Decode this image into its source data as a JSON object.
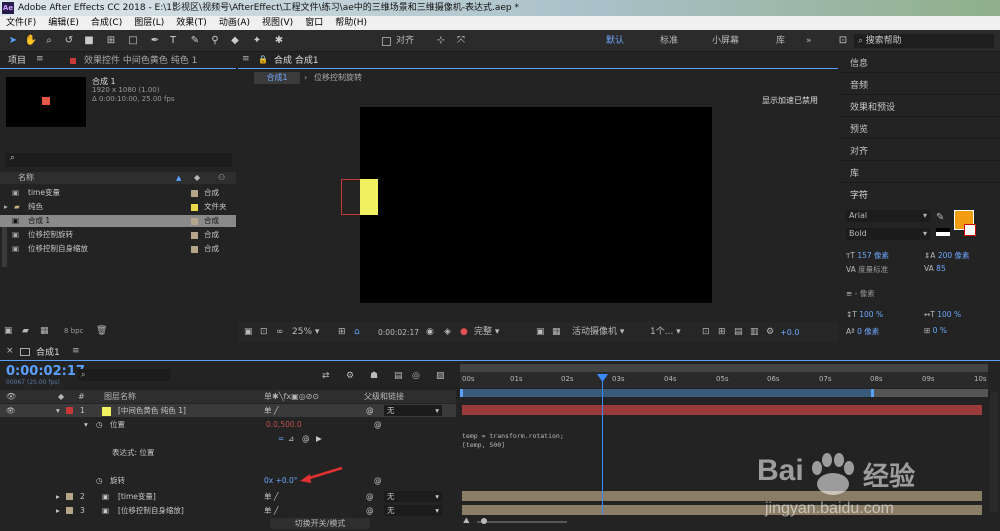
{
  "app": {
    "title": "Adobe After Effects CC 2018 - E:\\1影视区\\视频号\\AfterEffect\\工程文件\\练习\\ae中的三维场景和三维摄像机-表达式.aep *",
    "logo": "Ae"
  },
  "menu": [
    "文件(F)",
    "编辑(E)",
    "合成(C)",
    "图层(L)",
    "效果(T)",
    "动画(A)",
    "视图(V)",
    "窗口",
    "帮助(H)"
  ],
  "toolbar": {
    "align_label": "对齐",
    "workspaces": [
      "默认",
      "标准",
      "小屏幕",
      "库"
    ],
    "search_placeholder": "搜索帮助"
  },
  "project": {
    "tab_label": "项目",
    "effects_tab_label": "效果控件 中间色黄色 纯色 1",
    "comp_name": "合成 1",
    "comp_details": [
      "1920 x 1080 (1.00)",
      "Δ 0:00:10:00, 25.00 fps"
    ],
    "col_name": "名称",
    "items": [
      {
        "name": "time变量",
        "type": "合成",
        "color": "#b5a68a"
      },
      {
        "name": "纯色",
        "type": "文件夹",
        "color": "#e8d84a"
      },
      {
        "name": "合成 1",
        "type": "合成",
        "color": "#b5a68a"
      },
      {
        "name": "位移控制旋转",
        "type": "合成",
        "color": "#b5a68a"
      },
      {
        "name": "位移控制自身缩放",
        "type": "合成",
        "color": "#b5a68a"
      }
    ],
    "bpc": "8 bpc"
  },
  "viewer": {
    "tab_label": "合成 合成1",
    "subtabs": [
      "合成1",
      "位移控制旋转"
    ],
    "accel_note": "显示加速已禁用",
    "zoom": "25%",
    "timecode": "0:00:02:17",
    "quality": "完整",
    "camera": "活动摄像机",
    "views": "1个...",
    "exposure": "+0.0"
  },
  "right_panel": {
    "items": [
      "信息",
      "音频",
      "效果和预设",
      "预览",
      "对齐",
      "库"
    ],
    "character_label": "字符",
    "font": "Arial",
    "style": "Bold",
    "font_size": "157 像素",
    "leading": "200 像素",
    "kerning": "度量标准",
    "tracking": "85",
    "stroke_width": "- 像素",
    "vscale": "100 %",
    "hscale": "100 %",
    "baseline": "0 像素",
    "tsume": "0 %",
    "fill_color": "#f39c12"
  },
  "timeline": {
    "comp_tab": "合成1",
    "current_time": "0:00:02:17",
    "frame_info": "00067 (25.00 fps)",
    "col_layer_name": "图层名称",
    "col_parent": "父级和链接",
    "ruler": [
      "00s",
      "01s",
      "02s",
      "03s",
      "04s",
      "05s",
      "06s",
      "07s",
      "08s",
      "09s",
      "10s"
    ],
    "layers": [
      {
        "num": "1",
        "name": "[中间色黄色 纯色 1]",
        "color": "#c83a3a",
        "parent": "无"
      },
      {
        "num": "2",
        "name": "[time变量]",
        "color": "#b5a68a",
        "parent": "无"
      },
      {
        "num": "3",
        "name": "[位移控制自身缩放]",
        "color": "#b5a68a",
        "parent": "无"
      }
    ],
    "position_label": "位置",
    "position_value": "0.0,500.0",
    "expression_label": "表达式: 位置",
    "rotation_label": "旋转",
    "rotation_value": "0x +0.0°",
    "expression_code": [
      "temp = transform.rotation;",
      "[temp, 500]"
    ],
    "toggle_label": "切换开关/模式"
  },
  "watermark": {
    "brand": "Bai",
    "brand2": "经验",
    "url": "jingyan.baidu.com"
  }
}
